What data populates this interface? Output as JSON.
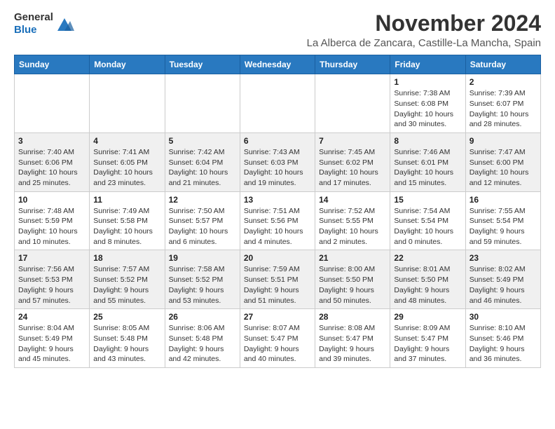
{
  "header": {
    "logo_line1": "General",
    "logo_line2": "Blue",
    "month_title": "November 2024",
    "location": "La Alberca de Zancara, Castille-La Mancha, Spain"
  },
  "weekdays": [
    "Sunday",
    "Monday",
    "Tuesday",
    "Wednesday",
    "Thursday",
    "Friday",
    "Saturday"
  ],
  "weeks": [
    [
      {
        "day": "",
        "info": ""
      },
      {
        "day": "",
        "info": ""
      },
      {
        "day": "",
        "info": ""
      },
      {
        "day": "",
        "info": ""
      },
      {
        "day": "",
        "info": ""
      },
      {
        "day": "1",
        "info": "Sunrise: 7:38 AM\nSunset: 6:08 PM\nDaylight: 10 hours and 30 minutes."
      },
      {
        "day": "2",
        "info": "Sunrise: 7:39 AM\nSunset: 6:07 PM\nDaylight: 10 hours and 28 minutes."
      }
    ],
    [
      {
        "day": "3",
        "info": "Sunrise: 7:40 AM\nSunset: 6:06 PM\nDaylight: 10 hours and 25 minutes."
      },
      {
        "day": "4",
        "info": "Sunrise: 7:41 AM\nSunset: 6:05 PM\nDaylight: 10 hours and 23 minutes."
      },
      {
        "day": "5",
        "info": "Sunrise: 7:42 AM\nSunset: 6:04 PM\nDaylight: 10 hours and 21 minutes."
      },
      {
        "day": "6",
        "info": "Sunrise: 7:43 AM\nSunset: 6:03 PM\nDaylight: 10 hours and 19 minutes."
      },
      {
        "day": "7",
        "info": "Sunrise: 7:45 AM\nSunset: 6:02 PM\nDaylight: 10 hours and 17 minutes."
      },
      {
        "day": "8",
        "info": "Sunrise: 7:46 AM\nSunset: 6:01 PM\nDaylight: 10 hours and 15 minutes."
      },
      {
        "day": "9",
        "info": "Sunrise: 7:47 AM\nSunset: 6:00 PM\nDaylight: 10 hours and 12 minutes."
      }
    ],
    [
      {
        "day": "10",
        "info": "Sunrise: 7:48 AM\nSunset: 5:59 PM\nDaylight: 10 hours and 10 minutes."
      },
      {
        "day": "11",
        "info": "Sunrise: 7:49 AM\nSunset: 5:58 PM\nDaylight: 10 hours and 8 minutes."
      },
      {
        "day": "12",
        "info": "Sunrise: 7:50 AM\nSunset: 5:57 PM\nDaylight: 10 hours and 6 minutes."
      },
      {
        "day": "13",
        "info": "Sunrise: 7:51 AM\nSunset: 5:56 PM\nDaylight: 10 hours and 4 minutes."
      },
      {
        "day": "14",
        "info": "Sunrise: 7:52 AM\nSunset: 5:55 PM\nDaylight: 10 hours and 2 minutes."
      },
      {
        "day": "15",
        "info": "Sunrise: 7:54 AM\nSunset: 5:54 PM\nDaylight: 10 hours and 0 minutes."
      },
      {
        "day": "16",
        "info": "Sunrise: 7:55 AM\nSunset: 5:54 PM\nDaylight: 9 hours and 59 minutes."
      }
    ],
    [
      {
        "day": "17",
        "info": "Sunrise: 7:56 AM\nSunset: 5:53 PM\nDaylight: 9 hours and 57 minutes."
      },
      {
        "day": "18",
        "info": "Sunrise: 7:57 AM\nSunset: 5:52 PM\nDaylight: 9 hours and 55 minutes."
      },
      {
        "day": "19",
        "info": "Sunrise: 7:58 AM\nSunset: 5:52 PM\nDaylight: 9 hours and 53 minutes."
      },
      {
        "day": "20",
        "info": "Sunrise: 7:59 AM\nSunset: 5:51 PM\nDaylight: 9 hours and 51 minutes."
      },
      {
        "day": "21",
        "info": "Sunrise: 8:00 AM\nSunset: 5:50 PM\nDaylight: 9 hours and 50 minutes."
      },
      {
        "day": "22",
        "info": "Sunrise: 8:01 AM\nSunset: 5:50 PM\nDaylight: 9 hours and 48 minutes."
      },
      {
        "day": "23",
        "info": "Sunrise: 8:02 AM\nSunset: 5:49 PM\nDaylight: 9 hours and 46 minutes."
      }
    ],
    [
      {
        "day": "24",
        "info": "Sunrise: 8:04 AM\nSunset: 5:49 PM\nDaylight: 9 hours and 45 minutes."
      },
      {
        "day": "25",
        "info": "Sunrise: 8:05 AM\nSunset: 5:48 PM\nDaylight: 9 hours and 43 minutes."
      },
      {
        "day": "26",
        "info": "Sunrise: 8:06 AM\nSunset: 5:48 PM\nDaylight: 9 hours and 42 minutes."
      },
      {
        "day": "27",
        "info": "Sunrise: 8:07 AM\nSunset: 5:47 PM\nDaylight: 9 hours and 40 minutes."
      },
      {
        "day": "28",
        "info": "Sunrise: 8:08 AM\nSunset: 5:47 PM\nDaylight: 9 hours and 39 minutes."
      },
      {
        "day": "29",
        "info": "Sunrise: 8:09 AM\nSunset: 5:47 PM\nDaylight: 9 hours and 37 minutes."
      },
      {
        "day": "30",
        "info": "Sunrise: 8:10 AM\nSunset: 5:46 PM\nDaylight: 9 hours and 36 minutes."
      }
    ]
  ]
}
